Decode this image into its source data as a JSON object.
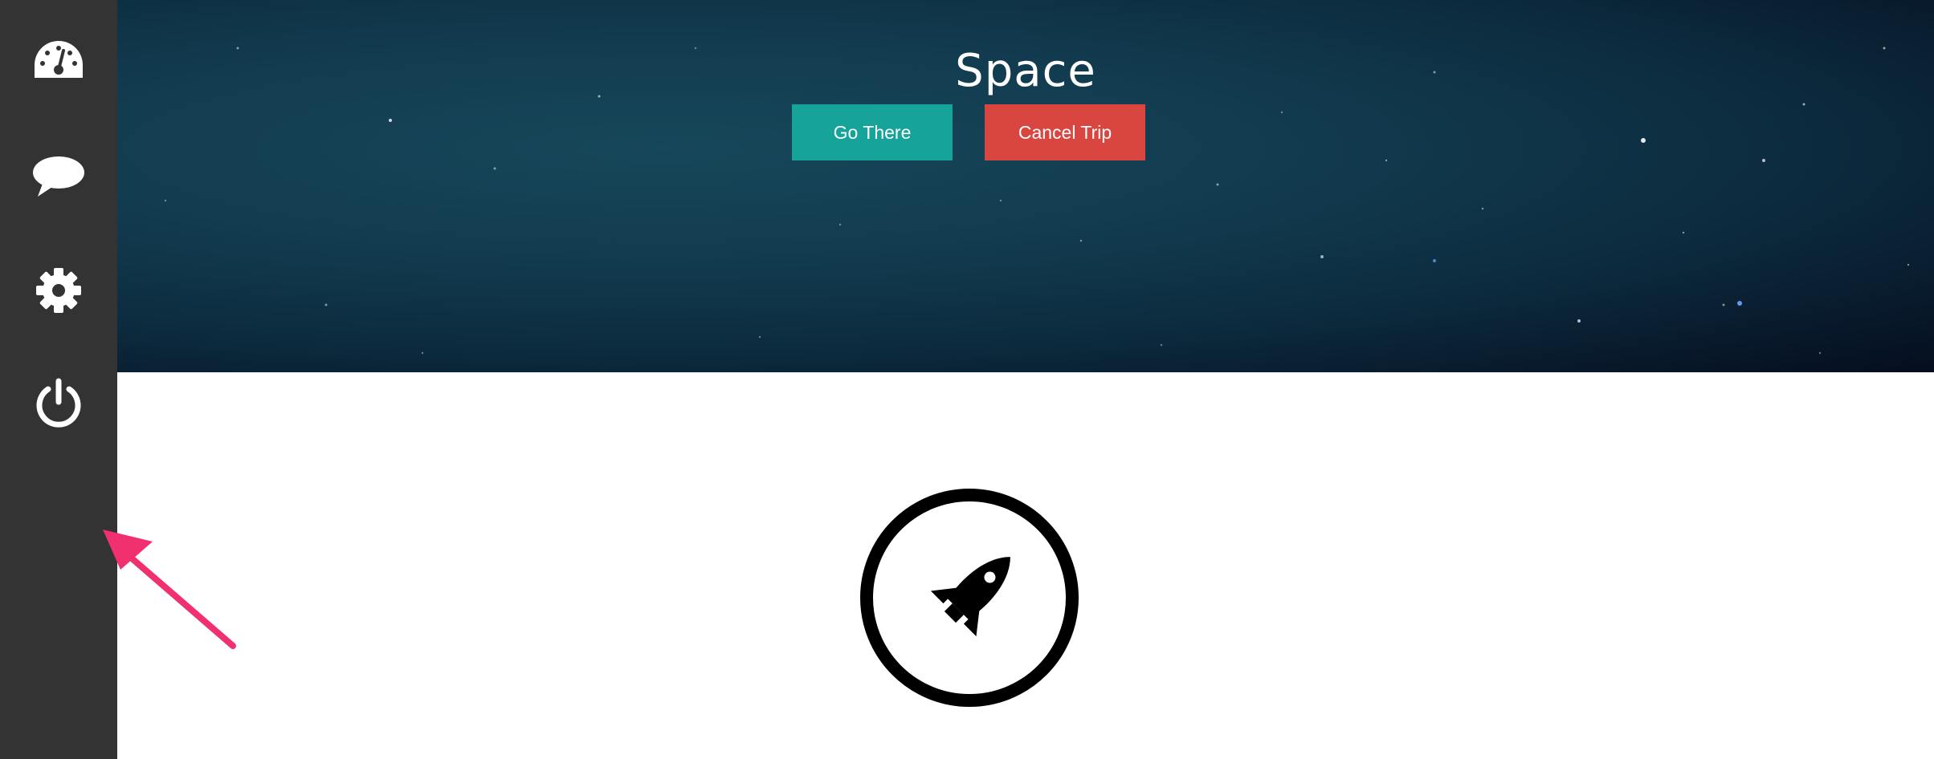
{
  "sidebar": {
    "items": [
      {
        "icon": "dashboard-icon"
      },
      {
        "icon": "chat-icon"
      },
      {
        "icon": "gear-icon"
      },
      {
        "icon": "power-icon"
      }
    ],
    "background": "#333333"
  },
  "hero": {
    "title": "Space",
    "buttons": {
      "go_label": "Go There",
      "cancel_label": "Cancel Trip"
    }
  },
  "main": {
    "icon": "rocket-icon"
  },
  "annotation": {
    "icon": "pink-arrow-icon",
    "color": "#f0306f"
  },
  "colors": {
    "go": "#16a39a",
    "cancel": "#d9463f",
    "hero_bg": "#123b4f"
  }
}
